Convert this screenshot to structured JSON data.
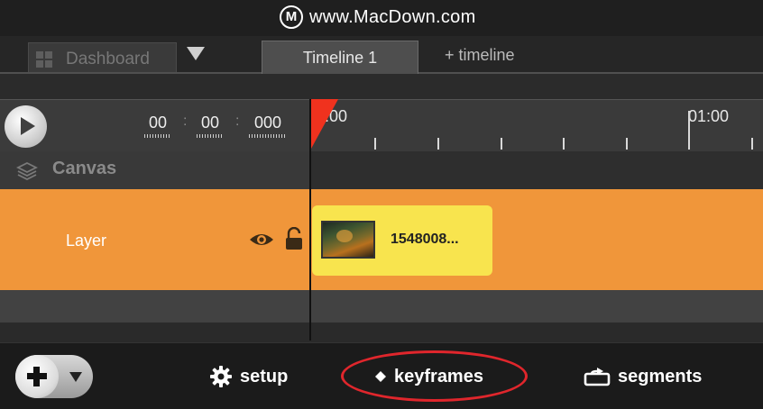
{
  "watermark": {
    "logo": "M",
    "text": "www.MacDown.com"
  },
  "tabs": {
    "dashboard_label": "Dashboard",
    "active_label": "Timeline 1",
    "add_label": "+ timeline"
  },
  "timecode": {
    "minutes": "00",
    "seconds": "00",
    "millis": "000",
    "sep": ":"
  },
  "ruler": {
    "start_label": ":00",
    "mark_label": "01:00"
  },
  "tracks": {
    "canvas_label": "Canvas",
    "layer_label": "Layer",
    "clip_label": "1548008..."
  },
  "bottom": {
    "setup_label": "setup",
    "keyframes_label": "keyframes",
    "segments_label": "segments"
  },
  "colors": {
    "playhead": "#f0321e",
    "layer_row": "#f0963a",
    "clip": "#f8e44e",
    "highlight": "#e0262c"
  }
}
